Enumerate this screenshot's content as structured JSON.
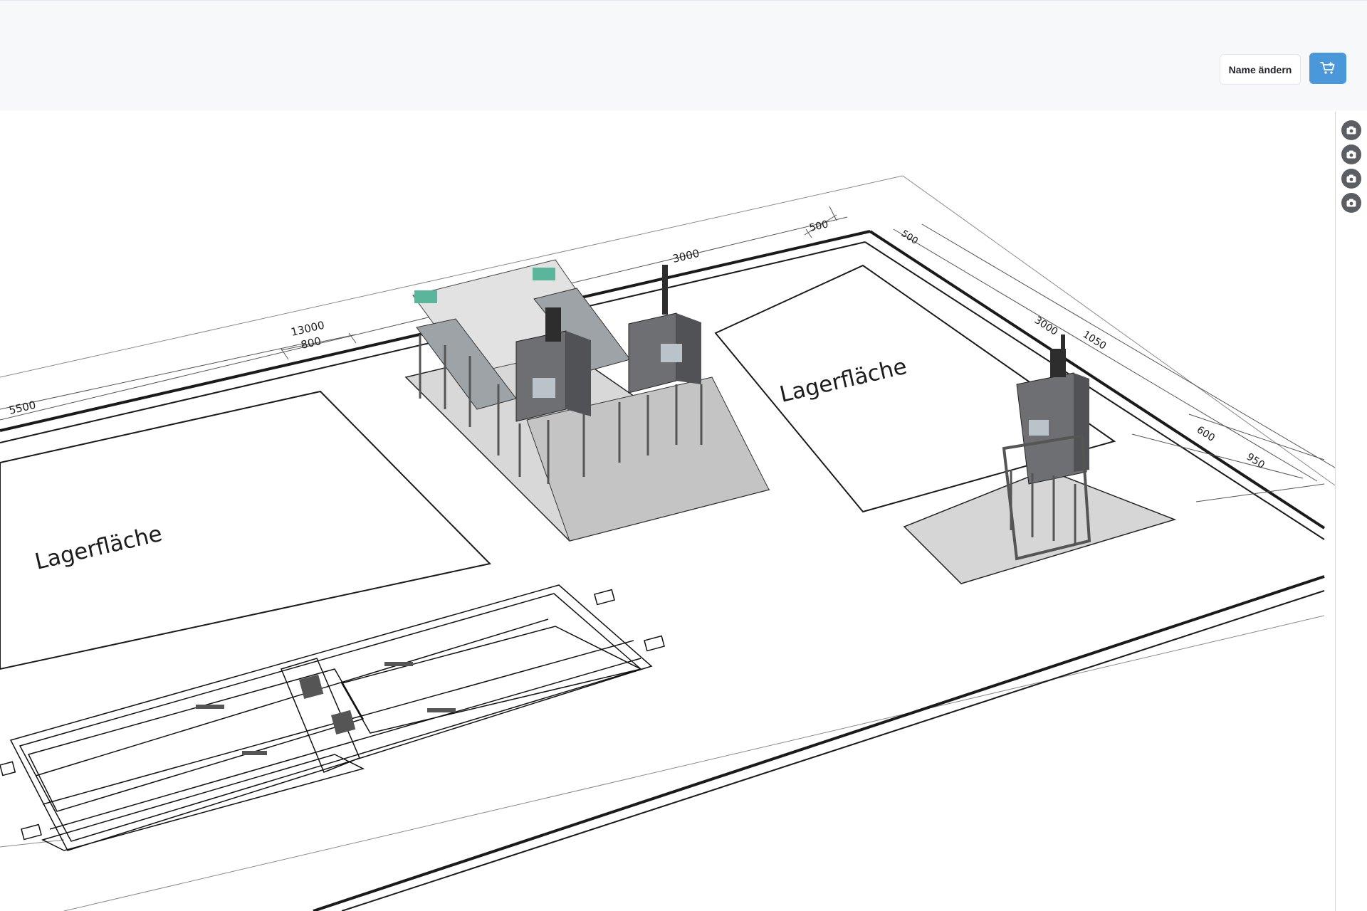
{
  "header": {
    "rename_label": "Name ändern",
    "cart_icon": "cart-icon"
  },
  "toolbar": {
    "buttons": [
      {
        "icon": "camera-icon"
      },
      {
        "icon": "camera-icon"
      },
      {
        "icon": "camera-icon"
      },
      {
        "icon": "camera-icon"
      }
    ]
  },
  "floorplan": {
    "area_labels": [
      "Lagerfläche",
      "Lagerfläche"
    ],
    "dimensions": [
      "5500",
      "13000",
      "800",
      "3000",
      "500",
      "500",
      "3000",
      "1050",
      "600",
      "950"
    ]
  },
  "colors": {
    "accent": "#4a97da",
    "header_bg": "#f6f8fa",
    "camera_button": "#5b5f64"
  }
}
